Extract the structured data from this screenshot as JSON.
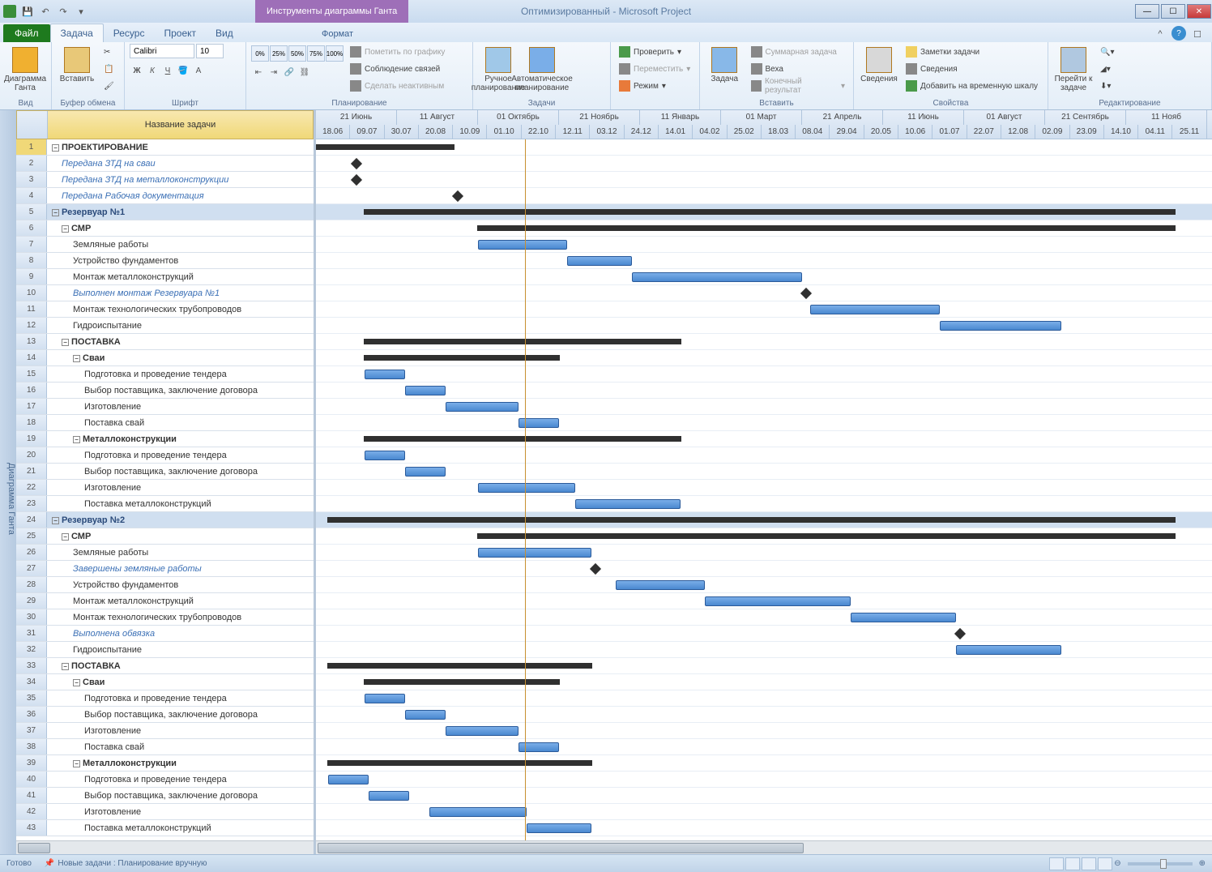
{
  "title": "Оптимизированный - Microsoft Project",
  "context_tab": "Инструменты диаграммы Ганта",
  "file_tab": "Файл",
  "tabs": [
    "Задача",
    "Ресурс",
    "Проект",
    "Вид"
  ],
  "format_tab": "Формат",
  "ribbon": {
    "view": {
      "big": "Диаграмма\nГанта",
      "label": "Вид"
    },
    "clipboard": {
      "big": "Вставить",
      "label": "Буфер обмена"
    },
    "font": {
      "name": "Calibri",
      "size": "10",
      "label": "Шрифт"
    },
    "schedule": {
      "label": "Планирование",
      "pct": [
        "0%",
        "25%",
        "50%",
        "75%",
        "100%"
      ],
      "items": [
        "Пометить по графику",
        "Соблюдение связей",
        "Сделать неактивным"
      ]
    },
    "tasks": {
      "manual": "Ручное\nпланирование",
      "auto": "Автоматическое\nпланирование",
      "label": "Задачи"
    },
    "tasks2": {
      "check": "Проверить",
      "move": "Переместить",
      "mode": "Режим"
    },
    "insert": {
      "big": "Задача",
      "items": [
        "Суммарная задача",
        "Веха",
        "Конечный результат"
      ],
      "label": "Вставить"
    },
    "props": {
      "big": "Сведения",
      "items": [
        "Заметки задачи",
        "Сведения",
        "Добавить на временную шкалу"
      ],
      "label": "Свойства"
    },
    "edit": {
      "big": "Перейти\nк задаче",
      "label": "Редактирование"
    }
  },
  "side_label": "Диаграмма Ганта",
  "col_header": "Название задачи",
  "timescale_major": [
    "21 Июнь",
    "11 Август",
    "01 Октябрь",
    "21 Ноябрь",
    "11 Январь",
    "01 Март",
    "21 Апрель",
    "11 Июнь",
    "01 Август",
    "21 Сентябрь",
    "11 Нояб"
  ],
  "timescale_minor": [
    "18.06",
    "09.07",
    "30.07",
    "20.08",
    "10.09",
    "01.10",
    "22.10",
    "12.11",
    "03.12",
    "24.12",
    "14.01",
    "04.02",
    "25.02",
    "18.03",
    "08.04",
    "29.04",
    "20.05",
    "10.06",
    "01.07",
    "22.07",
    "12.08",
    "02.09",
    "23.09",
    "14.10",
    "04.11",
    "25.11"
  ],
  "tasks": [
    {
      "n": 1,
      "name": "ПРОЕКТИРОВАНИЕ",
      "lvl": 0,
      "bold": true,
      "type": "sum",
      "s": 0,
      "e": 170
    },
    {
      "n": 2,
      "name": "Передана ЗТД на сваи",
      "lvl": 1,
      "blue": true,
      "type": "ms",
      "s": 45
    },
    {
      "n": 3,
      "name": "Передана ЗТД на металлоконструкции",
      "lvl": 1,
      "blue": true,
      "type": "ms",
      "s": 45
    },
    {
      "n": 4,
      "name": "Передана Рабочая документация",
      "lvl": 1,
      "blue": true,
      "type": "ms",
      "s": 170
    },
    {
      "n": 5,
      "name": "Резервуар №1",
      "lvl": 0,
      "bold": true,
      "summary": true,
      "type": "sum",
      "s": 60,
      "e": 1060
    },
    {
      "n": 6,
      "name": "СМР",
      "lvl": 1,
      "bold": true,
      "type": "sum",
      "s": 200,
      "e": 1060
    },
    {
      "n": 7,
      "name": "Земляные работы",
      "lvl": 2,
      "type": "bar",
      "s": 200,
      "e": 310
    },
    {
      "n": 8,
      "name": "Устройство фундаментов",
      "lvl": 2,
      "type": "bar",
      "s": 310,
      "e": 390
    },
    {
      "n": 9,
      "name": "Монтаж металлоконструкций",
      "lvl": 2,
      "type": "bar",
      "s": 390,
      "e": 600
    },
    {
      "n": 10,
      "name": "Выполнен монтаж Резервуара №1",
      "lvl": 2,
      "blue": true,
      "type": "ms",
      "s": 600
    },
    {
      "n": 11,
      "name": "Монтаж технологических трубопроводов",
      "lvl": 2,
      "type": "bar",
      "s": 610,
      "e": 770
    },
    {
      "n": 12,
      "name": "Гидроиспытание",
      "lvl": 2,
      "type": "bar",
      "s": 770,
      "e": 920
    },
    {
      "n": 13,
      "name": "ПОСТАВКА",
      "lvl": 1,
      "bold": true,
      "type": "sum",
      "s": 60,
      "e": 450
    },
    {
      "n": 14,
      "name": "Сваи",
      "lvl": 2,
      "bold": true,
      "type": "sum",
      "s": 60,
      "e": 300
    },
    {
      "n": 15,
      "name": "Подготовка и проведение тендера",
      "lvl": 3,
      "type": "bar",
      "s": 60,
      "e": 110
    },
    {
      "n": 16,
      "name": "Выбор поставщика, заключение договора",
      "lvl": 3,
      "type": "bar",
      "s": 110,
      "e": 160
    },
    {
      "n": 17,
      "name": "Изготовление",
      "lvl": 3,
      "type": "bar",
      "s": 160,
      "e": 250
    },
    {
      "n": 18,
      "name": "Поставка свай",
      "lvl": 3,
      "type": "bar",
      "s": 250,
      "e": 300
    },
    {
      "n": 19,
      "name": "Металлоконструкции",
      "lvl": 2,
      "bold": true,
      "type": "sum",
      "s": 60,
      "e": 450
    },
    {
      "n": 20,
      "name": "Подготовка и проведение тендера",
      "lvl": 3,
      "type": "bar",
      "s": 60,
      "e": 110
    },
    {
      "n": 21,
      "name": "Выбор поставщика, заключение договора",
      "lvl": 3,
      "type": "bar",
      "s": 110,
      "e": 160
    },
    {
      "n": 22,
      "name": "Изготовление",
      "lvl": 3,
      "type": "bar",
      "s": 200,
      "e": 320
    },
    {
      "n": 23,
      "name": "Поставка металлоконструкций",
      "lvl": 3,
      "type": "bar",
      "s": 320,
      "e": 450
    },
    {
      "n": 24,
      "name": "Резервуар №2",
      "lvl": 0,
      "bold": true,
      "summary": true,
      "type": "sum",
      "s": 15,
      "e": 1060
    },
    {
      "n": 25,
      "name": "СМР",
      "lvl": 1,
      "bold": true,
      "type": "sum",
      "s": 200,
      "e": 1060
    },
    {
      "n": 26,
      "name": "Земляные работы",
      "lvl": 2,
      "type": "bar",
      "s": 200,
      "e": 340
    },
    {
      "n": 27,
      "name": "Завершены земляные работы",
      "lvl": 2,
      "blue": true,
      "type": "ms",
      "s": 340
    },
    {
      "n": 28,
      "name": "Устройство фундаментов",
      "lvl": 2,
      "type": "bar",
      "s": 370,
      "e": 480
    },
    {
      "n": 29,
      "name": "Монтаж металлоконструкций",
      "lvl": 2,
      "type": "bar",
      "s": 480,
      "e": 660
    },
    {
      "n": 30,
      "name": "Монтаж технологических трубопроводов",
      "lvl": 2,
      "type": "bar",
      "s": 660,
      "e": 790
    },
    {
      "n": 31,
      "name": "Выполнена обвязка",
      "lvl": 2,
      "blue": true,
      "type": "ms",
      "s": 790
    },
    {
      "n": 32,
      "name": "Гидроиспытание",
      "lvl": 2,
      "type": "bar",
      "s": 790,
      "e": 920
    },
    {
      "n": 33,
      "name": "ПОСТАВКА",
      "lvl": 1,
      "bold": true,
      "type": "sum",
      "s": 15,
      "e": 340
    },
    {
      "n": 34,
      "name": "Сваи",
      "lvl": 2,
      "bold": true,
      "type": "sum",
      "s": 60,
      "e": 300
    },
    {
      "n": 35,
      "name": "Подготовка и проведение тендера",
      "lvl": 3,
      "type": "bar",
      "s": 60,
      "e": 110
    },
    {
      "n": 36,
      "name": "Выбор поставщика, заключение договора",
      "lvl": 3,
      "type": "bar",
      "s": 110,
      "e": 160
    },
    {
      "n": 37,
      "name": "Изготовление",
      "lvl": 3,
      "type": "bar",
      "s": 160,
      "e": 250
    },
    {
      "n": 38,
      "name": "Поставка свай",
      "lvl": 3,
      "type": "bar",
      "s": 250,
      "e": 300
    },
    {
      "n": 39,
      "name": "Металлоконструкции",
      "lvl": 2,
      "bold": true,
      "type": "sum",
      "s": 15,
      "e": 340
    },
    {
      "n": 40,
      "name": "Подготовка и проведение тендера",
      "lvl": 3,
      "type": "bar",
      "s": 15,
      "e": 65
    },
    {
      "n": 41,
      "name": "Выбор поставщика, заключение договора",
      "lvl": 3,
      "type": "bar",
      "s": 65,
      "e": 115
    },
    {
      "n": 42,
      "name": "Изготовление",
      "lvl": 3,
      "type": "bar",
      "s": 140,
      "e": 260
    },
    {
      "n": 43,
      "name": "Поставка металлоконструкций",
      "lvl": 3,
      "type": "bar",
      "s": 260,
      "e": 340
    }
  ],
  "statusbar": {
    "ready": "Готово",
    "hint": "Новые задачи : Планирование вручную"
  }
}
